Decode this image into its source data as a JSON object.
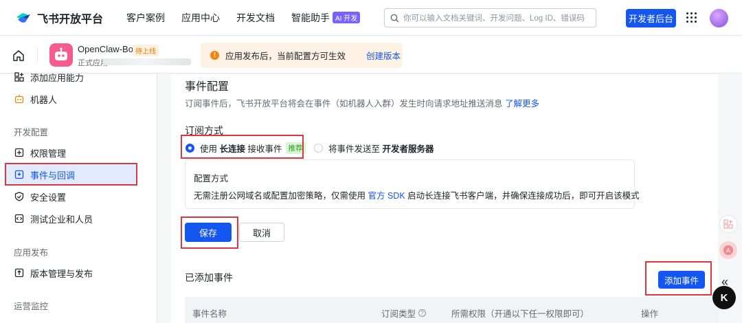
{
  "topnav": {
    "logo_text": "飞书开放平台",
    "items": [
      {
        "label": "客户案例"
      },
      {
        "label": "应用中心"
      },
      {
        "label": "开发文档"
      },
      {
        "label": "智能助手",
        "badge": "AI 开发"
      }
    ],
    "search_placeholder": "你可以输入文档关键词、开发问题、Log ID、错误码",
    "dev_button": "开发者后台"
  },
  "app": {
    "name": "OpenClaw-Bot",
    "status_tag": "待上线",
    "subtitle": "正式应用"
  },
  "notice": {
    "text": "应用发布后，当前配置方可生效",
    "link": "创建版本"
  },
  "sidebar": {
    "items_top": [
      {
        "label": "添加应用能力",
        "icon": "add-ability-icon"
      },
      {
        "label": "机器人",
        "icon": "robot-icon"
      }
    ],
    "group_dev": "开发配置",
    "items_dev": [
      {
        "label": "权限管理",
        "icon": "permission-icon"
      },
      {
        "label": "事件与回调",
        "icon": "event-icon",
        "active": true
      },
      {
        "label": "安全设置",
        "icon": "shield-icon"
      },
      {
        "label": "测试企业和人员",
        "icon": "code-icon"
      }
    ],
    "group_release": "应用发布",
    "items_release": [
      {
        "label": "版本管理与发布",
        "icon": "upload-icon"
      }
    ],
    "group_ops": "运营监控"
  },
  "main": {
    "title": "事件配置",
    "desc": "订阅事件后，飞书开放平台将会在事件（如机器人入群）发生时向请求地址推送消息",
    "desc_link": "了解更多",
    "subscribe_label": "订阅方式",
    "option1_prefix": "使用",
    "option1_bold": "长连接",
    "option1_suffix": "接收事件",
    "option1_tag": "推荐",
    "option2_prefix": "将事件发送至",
    "option2_bold": "开发者服务器",
    "config_title": "配置方式",
    "config_desc_1": "无需注册公网域名或配置加密策略，仅需使用",
    "config_desc_link": "官方 SDK",
    "config_desc_2": "启动长连接飞书客户端，并确保连接成功后，即可开启该模式",
    "save": "保存",
    "cancel": "取消",
    "added_title": "已添加事件",
    "add_event": "添加事件",
    "table_headers": [
      "事件名称",
      "订阅类型",
      "所需权限（开通以下任一权限即可）",
      "操作"
    ]
  },
  "colors": {
    "primary": "#1456f0",
    "highlight_red": "#d9363e"
  }
}
